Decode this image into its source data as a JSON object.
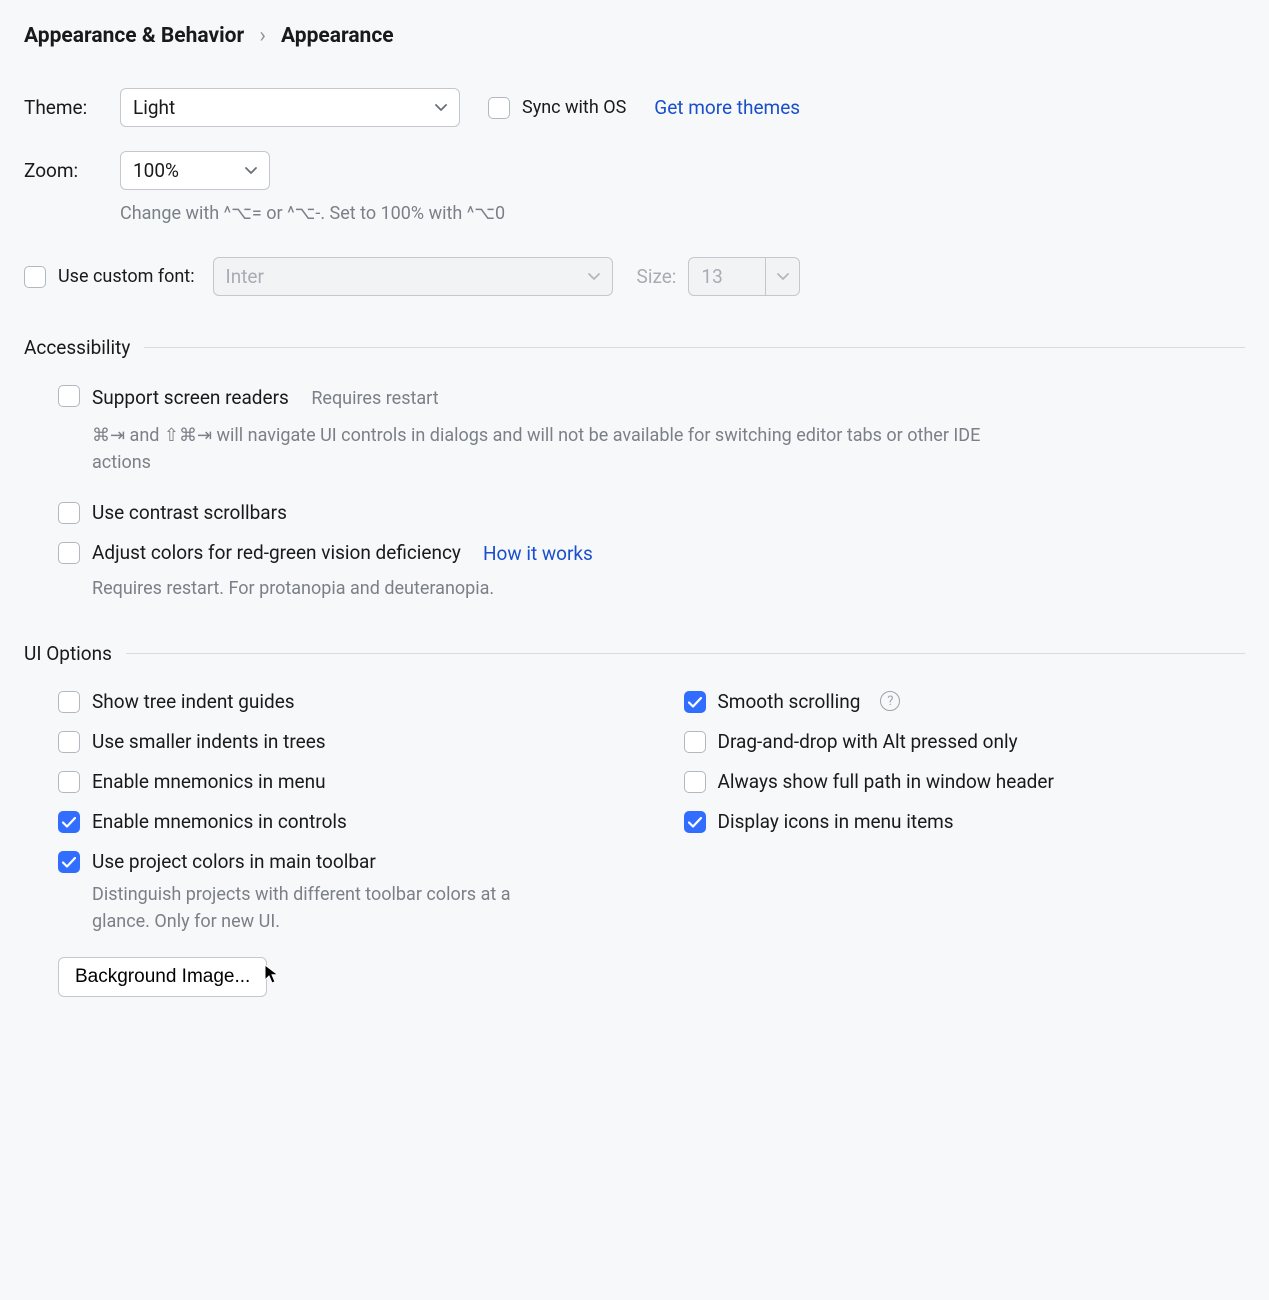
{
  "breadcrumb": {
    "level1": "Appearance & Behavior",
    "level2": "Appearance",
    "sep": "›"
  },
  "theme": {
    "label": "Theme:",
    "value": "Light",
    "sync_label": "Sync with OS",
    "more_link": "Get more themes"
  },
  "zoom": {
    "label": "Zoom:",
    "value": "100%",
    "hint": "Change with ^⌥= or ^⌥-. Set to 100% with ^⌥0"
  },
  "custom_font": {
    "label": "Use custom font:",
    "family": "Inter",
    "size_label": "Size:",
    "size_value": "13"
  },
  "accessibility": {
    "title": "Accessibility",
    "screen_readers": {
      "label": "Support screen readers",
      "note": "Requires restart",
      "desc": "⌘⇥ and ⇧⌘⇥ will navigate UI controls in dialogs and will not be available for switching editor tabs or other IDE actions"
    },
    "contrast_scrollbars": {
      "label": "Use contrast scrollbars"
    },
    "color_deficiency": {
      "label": "Adjust colors for red-green vision deficiency",
      "link": "How it works",
      "desc": "Requires restart. For protanopia and deuteranopia."
    }
  },
  "ui_options": {
    "title": "UI Options",
    "left": [
      {
        "label": "Show tree indent guides",
        "checked": false
      },
      {
        "label": "Use smaller indents in trees",
        "checked": false
      },
      {
        "label": "Enable mnemonics in menu",
        "checked": false
      },
      {
        "label": "Enable mnemonics in controls",
        "checked": true
      },
      {
        "label": "Use project colors in main toolbar",
        "checked": true,
        "desc": "Distinguish projects with different toolbar colors at a glance. Only for new UI."
      }
    ],
    "right": [
      {
        "label": "Smooth scrolling",
        "checked": true,
        "help": true
      },
      {
        "label": "Drag-and-drop with Alt pressed only",
        "checked": false
      },
      {
        "label": "Always show full path in window header",
        "checked": false
      },
      {
        "label": "Display icons in menu items",
        "checked": true
      }
    ],
    "background_btn": "Background Image..."
  }
}
